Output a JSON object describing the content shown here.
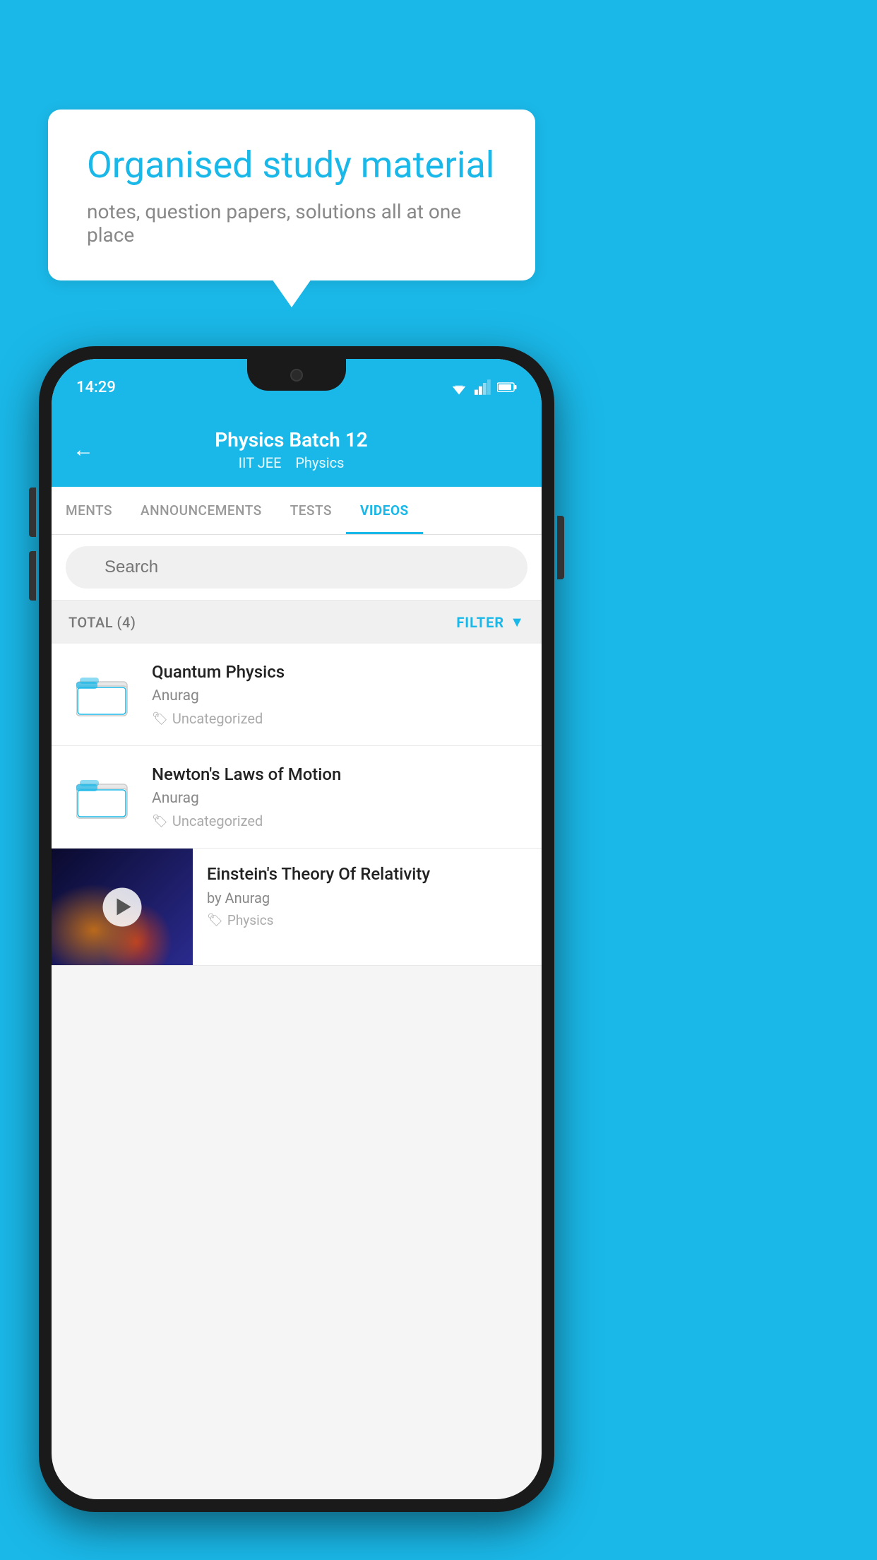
{
  "background_color": "#1ab8e8",
  "speech_bubble": {
    "title": "Organised study material",
    "subtitle": "notes, question papers, solutions all at one place"
  },
  "phone": {
    "status_bar": {
      "time": "14:29"
    },
    "header": {
      "back_label": "←",
      "title": "Physics Batch 12",
      "subtitle_parts": [
        "IIT JEE",
        "Physics"
      ]
    },
    "tabs": [
      {
        "label": "MENTS",
        "active": false
      },
      {
        "label": "ANNOUNCEMENTS",
        "active": false
      },
      {
        "label": "TESTS",
        "active": false
      },
      {
        "label": "VIDEOS",
        "active": true
      }
    ],
    "search": {
      "placeholder": "Search"
    },
    "filter_bar": {
      "total_label": "TOTAL (4)",
      "filter_label": "FILTER"
    },
    "videos": [
      {
        "id": "quantum-physics",
        "title": "Quantum Physics",
        "author": "Anurag",
        "tag": "Uncategorized",
        "type": "folder"
      },
      {
        "id": "newtons-laws",
        "title": "Newton's Laws of Motion",
        "author": "Anurag",
        "tag": "Uncategorized",
        "type": "folder"
      },
      {
        "id": "einsteins-theory",
        "title": "Einstein's Theory Of Relativity",
        "author": "by Anurag",
        "tag": "Physics",
        "type": "video"
      }
    ]
  }
}
